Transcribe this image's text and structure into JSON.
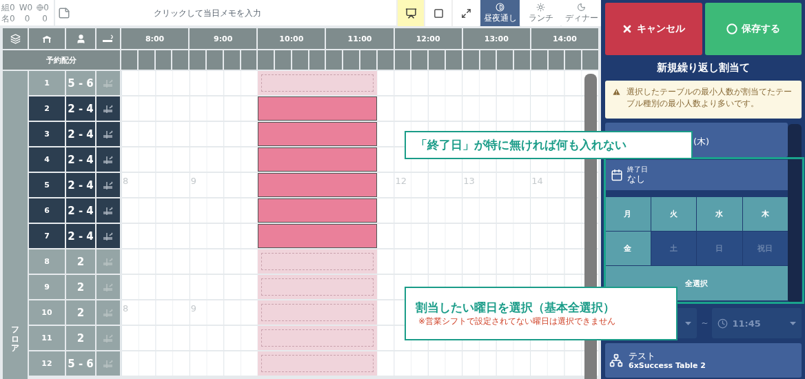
{
  "counters": [
    {
      "cells": [
        {
          "label": "組",
          "value": "0"
        },
        {
          "label": "W",
          "value": "0"
        },
        {
          "kind": "icon",
          "value": "0"
        }
      ]
    },
    {
      "cells": [
        {
          "label": "名",
          "value": "0"
        },
        {
          "value": "0"
        },
        {
          "value": "0"
        }
      ]
    }
  ],
  "memo": {
    "placeholder": "クリックして当日メモを入力"
  },
  "tools": [
    {
      "kind": "presenter",
      "on": true
    },
    {
      "kind": "square",
      "on": false
    },
    {
      "kind": "expand",
      "on": false
    }
  ],
  "modes": [
    {
      "kind": "allday",
      "label": "昼夜通し",
      "selected": true
    },
    {
      "kind": "lunch",
      "label": "ランチ",
      "selected": false
    },
    {
      "kind": "dinner",
      "label": "ディナー",
      "selected": false
    }
  ],
  "grid": {
    "hours": [
      "8:00",
      "9:00",
      "10:00",
      "11:00",
      "12:00",
      "13:00",
      "14:00"
    ],
    "allocation_label": "予約配分",
    "floor": "フロア",
    "rows": [
      {
        "number": "1",
        "capacity": "5 - 6",
        "selected": false
      },
      {
        "number": "2",
        "capacity": "2 - 4",
        "selected": true
      },
      {
        "number": "3",
        "capacity": "2 - 4",
        "selected": true
      },
      {
        "number": "4",
        "capacity": "2 - 4",
        "selected": true
      },
      {
        "number": "5",
        "capacity": "2 - 4",
        "selected": true,
        "hour_marks": {
          "before": [
            "8",
            "9"
          ],
          "after": [
            "12",
            "13",
            "14"
          ]
        }
      },
      {
        "number": "6",
        "capacity": "2 - 4",
        "selected": true
      },
      {
        "number": "7",
        "capacity": "2 - 4",
        "selected": true
      },
      {
        "number": "8",
        "capacity": "2",
        "selected": false
      },
      {
        "number": "9",
        "capacity": "2",
        "selected": false
      },
      {
        "number": "10",
        "capacity": "2",
        "selected": false,
        "hour_marks": {
          "before": [
            "8",
            "9"
          ]
        }
      },
      {
        "number": "11",
        "capacity": "2",
        "selected": false
      },
      {
        "number": "12",
        "capacity": "5 - 6",
        "selected": false
      }
    ]
  },
  "panel": {
    "cancel": "キャンセル",
    "save": "保存する",
    "title": "新規繰り返し割当て",
    "warning": "選択したテーブルの最小人数が割当てたテーブル種別の最小人数より多いです。",
    "start_date": {
      "value": "(木)"
    },
    "end_date": {
      "label": "終了日",
      "value": "なし"
    },
    "days": [
      {
        "label": "月",
        "selected": true
      },
      {
        "label": "火",
        "selected": true
      },
      {
        "label": "水",
        "selected": true
      },
      {
        "label": "木",
        "selected": true
      },
      {
        "label": "金",
        "selected": true
      },
      {
        "label": "土",
        "selected": false
      },
      {
        "label": "日",
        "selected": false
      },
      {
        "label": "祝日",
        "selected": false
      }
    ],
    "select_all": "全選択",
    "time": {
      "separator": "~",
      "end": "11:45"
    },
    "table_card": {
      "title": "テスト",
      "subtitle": "6xSuccess Table 2"
    }
  },
  "callouts": [
    {
      "title": "「終了日」が特に無ければ何も入れない"
    },
    {
      "title": "割当したい曜日を選択（基本全選択）",
      "note": "※営業シフトで設定されてない曜日は選択できません"
    }
  ]
}
